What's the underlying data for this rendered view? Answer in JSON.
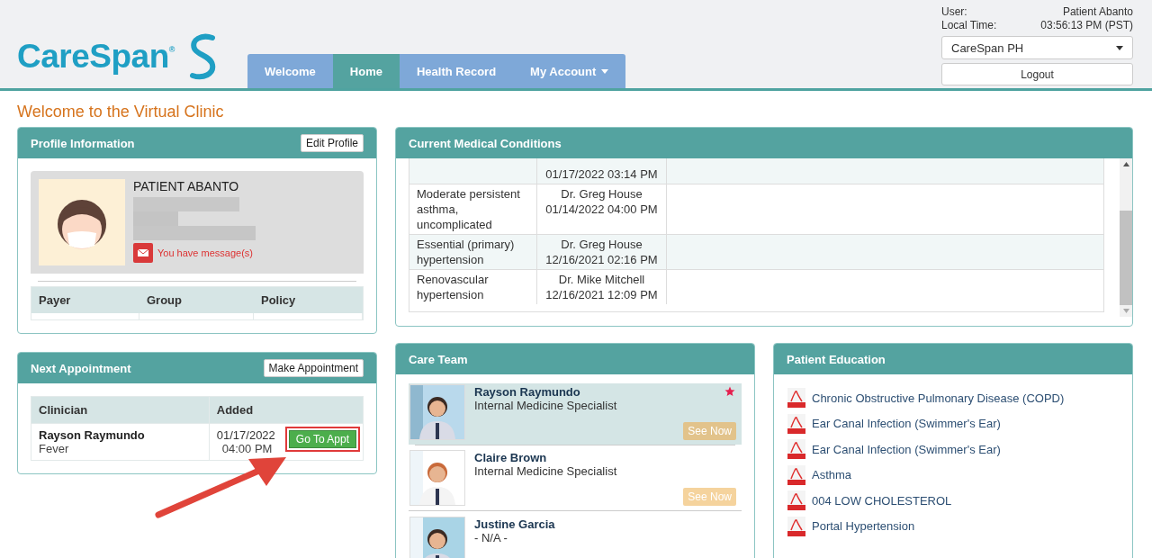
{
  "header": {
    "logo": "CareSpan$^{®}$",
    "tabs": [
      {
        "label": "Welcome",
        "selected": false,
        "has_menu": false
      },
      {
        "label": "Home",
        "selected": true,
        "has_menu": false
      },
      {
        "label": "Health Record",
        "selected": false,
        "has_menu": false
      },
      {
        "label": "My Account",
        "selected": false,
        "has_menu": true
      }
    ],
    "user_label": "User:",
    "user": "Patient Abanto",
    "time_label": "Local Time:",
    "time": "03:56:13 PM (PST)",
    "clinic": "CareSpan PH",
    "logout": "Logout"
  },
  "page_title": "Welcome to the Virtual Clinic",
  "profile": {
    "title": "Profile Information",
    "edit": "Edit Profile",
    "name": "PATIENT ABANTO",
    "message": "You have message(s)",
    "columns": [
      "Payer",
      "Group",
      "Policy"
    ]
  },
  "appointment": {
    "title": "Next Appointment",
    "make": "Make Appointment",
    "columns": [
      "Clinician",
      "Added"
    ],
    "rows": [
      {
        "clinician": "Rayson Raymundo",
        "reason": "Fever",
        "date": "01/17/2022",
        "time": "04:00 PM",
        "action": "Go To Appt",
        "highlighted": true
      }
    ]
  },
  "conditions": {
    "title": "Current Medical Conditions",
    "rows": [
      {
        "date": "01/17/2022 03:14 PM"
      },
      {
        "condition": "Moderate persistent asthma, uncomplicated",
        "doctor": "Dr. Greg House",
        "date": "01/14/2022 04:00 PM"
      },
      {
        "condition": "Essential (primary) hypertension",
        "doctor": "Dr. Greg House",
        "date": "12/16/2021 02:16 PM"
      },
      {
        "condition": "Renovascular hypertension",
        "doctor": "Dr. Mike Mitchell",
        "date": "12/16/2021 12:09 PM"
      }
    ]
  },
  "care_team": {
    "title": "Care Team",
    "members": [
      {
        "name": "Rayson Raymundo",
        "role": "Internal Medicine Specialist",
        "action": "See Now",
        "selected": true,
        "favorite": true
      },
      {
        "name": "Claire Brown",
        "role": "Internal Medicine Specialist",
        "action": "See Now",
        "selected": false,
        "favorite": false
      },
      {
        "name": "Justine Garcia",
        "role": "- N/A -",
        "selected": false,
        "favorite": false
      }
    ]
  },
  "education": {
    "title": "Patient Education",
    "items": [
      "Chronic Obstructive Pulmonary Disease (COPD)",
      "Ear Canal Infection (Swimmer's Ear)",
      "Ear Canal Infection (Swimmer's Ear)",
      "Asthma",
      "004 LOW CHOLESTEROL",
      "Portal Hypertension"
    ]
  }
}
